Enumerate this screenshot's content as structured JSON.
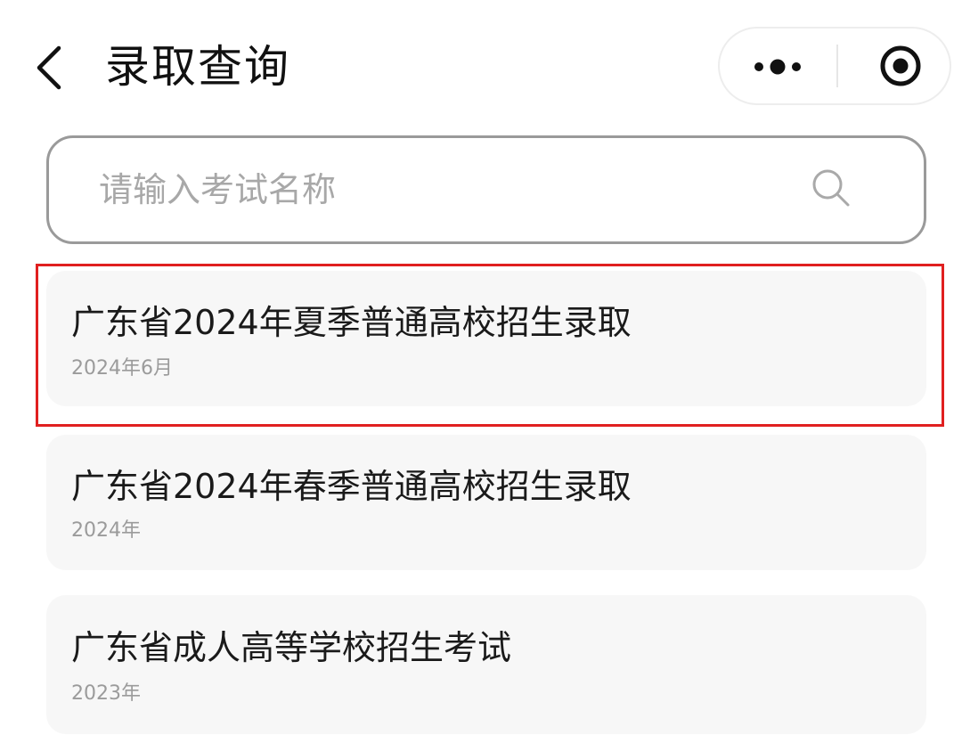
{
  "header": {
    "title": "录取查询"
  },
  "capsule": {
    "more_icon": "more-dots-icon",
    "close_icon": "target-circle-icon"
  },
  "search": {
    "placeholder": "请输入考试名称",
    "value": "",
    "icon": "search-icon"
  },
  "exams": [
    {
      "name": "广东省2024年夏季普通高校招生录取",
      "date": "2024年6月",
      "highlighted": true
    },
    {
      "name": "广东省2024年春季普通高校招生录取",
      "date": "2024年",
      "highlighted": false
    },
    {
      "name": "广东省成人高等学校招生考试",
      "date": "2023年",
      "highlighted": false
    }
  ],
  "colors": {
    "highlight_border": "#e02020",
    "card_background": "#f7f7f7",
    "search_border": "#9a9a9a"
  }
}
